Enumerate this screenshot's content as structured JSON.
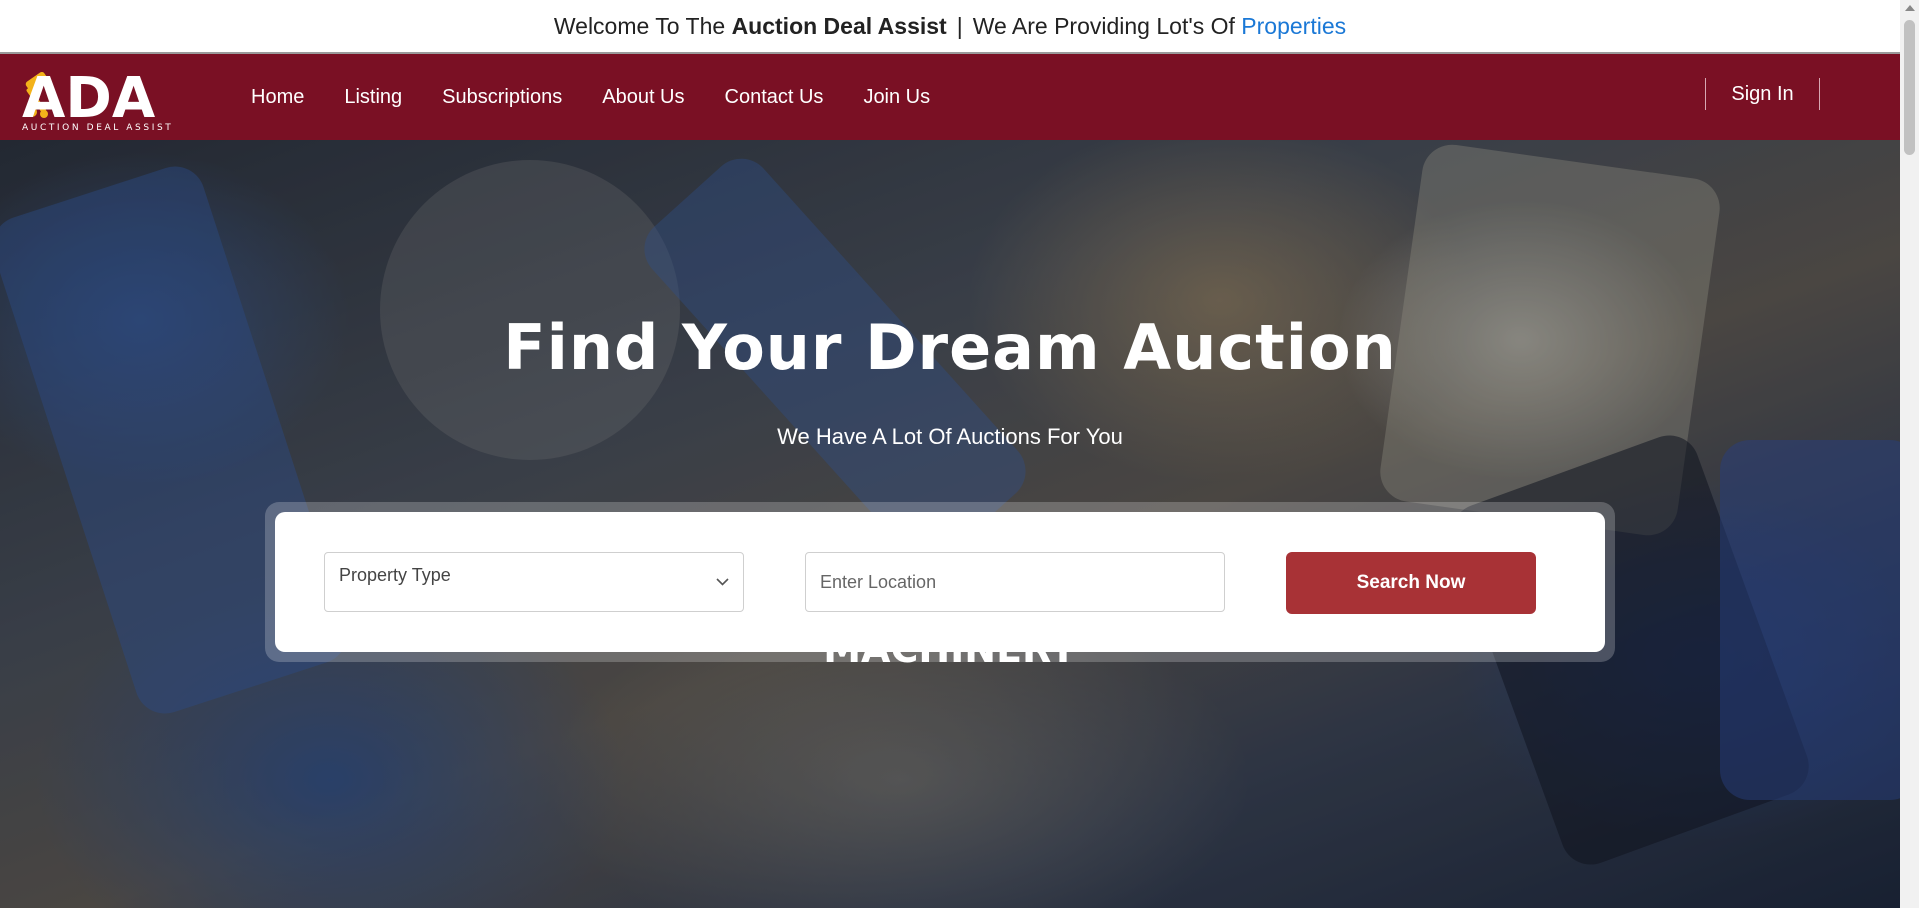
{
  "topbar": {
    "welcome_prefix": "Welcome To The",
    "brand": "Auction Deal Assist",
    "separator": "|",
    "providing_text": "We Are Providing Lot's Of",
    "properties_link": "Properties"
  },
  "logo": {
    "letters": "ADA",
    "tagline": "AUCTION DEAL ASSIST"
  },
  "nav": {
    "items": [
      {
        "label": "Home"
      },
      {
        "label": "Listing"
      },
      {
        "label": "Subscriptions"
      },
      {
        "label": "About Us"
      },
      {
        "label": "Contact Us"
      },
      {
        "label": "Join Us"
      }
    ],
    "sign_in": "Sign In"
  },
  "hero": {
    "title": "Find Your Dream Auction",
    "subtitle": "We Have A Lot Of Auctions For You",
    "category": "MACHINERY"
  },
  "search": {
    "property_type_label": "Property Type",
    "location_placeholder": "Enter Location",
    "button_label": "Search Now"
  },
  "colors": {
    "navbar": "#7a1024",
    "button": "#a83236",
    "link": "#1a78d6",
    "logo_accent": "#f3b21a"
  }
}
